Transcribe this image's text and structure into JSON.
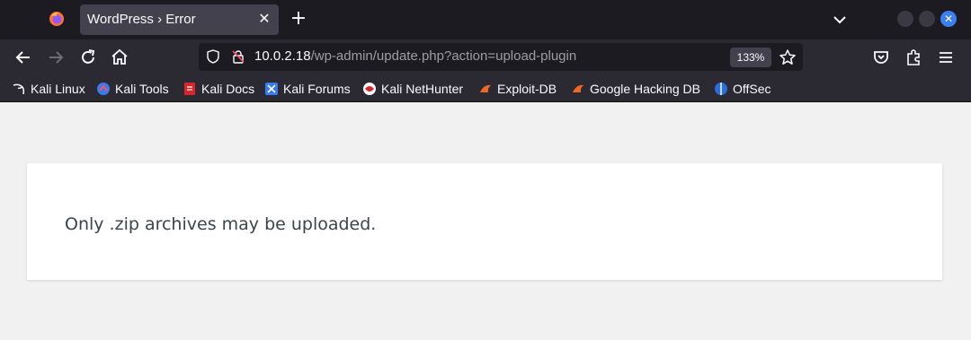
{
  "browser": {
    "tab": {
      "title": "WordPress › Error"
    },
    "url": {
      "host": "10.0.2.18",
      "path": "/wp-admin/update.php?action=upload-plugin"
    },
    "zoom": "133%"
  },
  "bookmarks": [
    {
      "label": "Kali Linux",
      "icon": "kali-dragon-icon"
    },
    {
      "label": "Kali Tools",
      "icon": "kali-tools-icon"
    },
    {
      "label": "Kali Docs",
      "icon": "kali-docs-icon"
    },
    {
      "label": "Kali Forums",
      "icon": "kali-forums-icon"
    },
    {
      "label": "Kali NetHunter",
      "icon": "nethunter-icon"
    },
    {
      "label": "Exploit-DB",
      "icon": "exploit-db-icon"
    },
    {
      "label": "Google Hacking DB",
      "icon": "ghdb-icon"
    },
    {
      "label": "OffSec",
      "icon": "offsec-icon"
    }
  ],
  "page": {
    "error_message": "Only .zip archives may be uploaded."
  },
  "colors": {
    "accent": "#3d7ff0",
    "page_background": "#f1f1f1",
    "browser_chrome": "#2b2a33"
  }
}
